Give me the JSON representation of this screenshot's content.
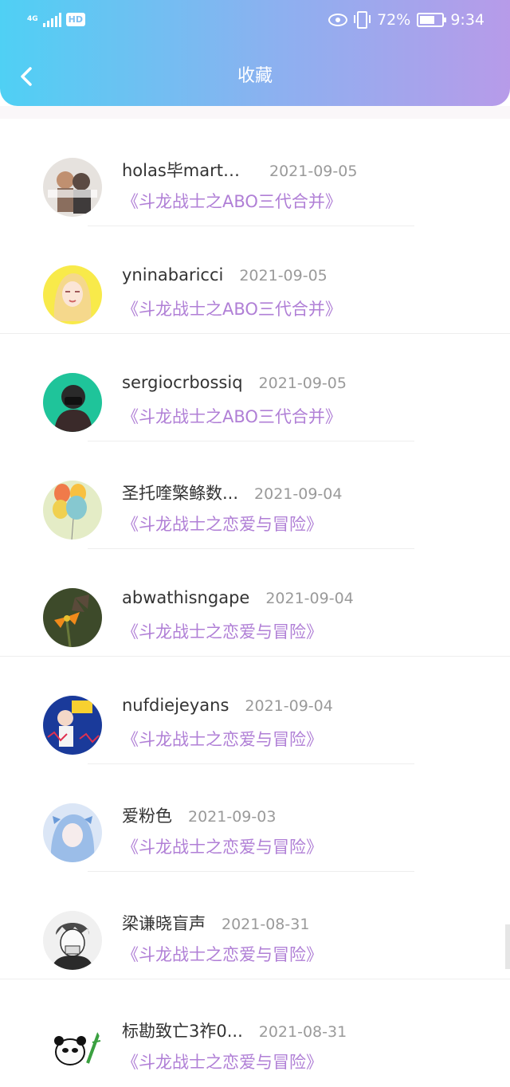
{
  "status_bar": {
    "network": "4G",
    "hd": "HD",
    "battery": "72%",
    "time": "9:34"
  },
  "header": {
    "title": "收藏"
  },
  "favorites": [
    {
      "name": "holas毕mart槎...",
      "date": "2021-09-05",
      "book": "《斗龙战士之ABO三代合并》",
      "avatar": "avatar-couple-photo"
    },
    {
      "name": "yninabaricci",
      "date": "2021-09-05",
      "book": "《斗龙战士之ABO三代合并》",
      "avatar": "avatar-blonde-anime-girl"
    },
    {
      "name": "sergiocrbossiq",
      "date": "2021-09-05",
      "book": "《斗龙战士之ABO三代合并》",
      "avatar": "avatar-masked-boy"
    },
    {
      "name": "圣托喹檠鲦数...",
      "date": "2021-09-04",
      "book": "《斗龙战士之恋爱与冒险》",
      "avatar": "avatar-balloons"
    },
    {
      "name": "abwathisngape",
      "date": "2021-09-04",
      "book": "《斗龙战士之恋爱与冒险》",
      "avatar": "avatar-butterfly-flower"
    },
    {
      "name": "nufdiejeyans",
      "date": "2021-09-04",
      "book": "《斗龙战士之恋爱与冒险》",
      "avatar": "avatar-cartoon-monday"
    },
    {
      "name": "爱粉色",
      "date": "2021-09-03",
      "book": "《斗龙战士之恋爱与冒险》",
      "avatar": "avatar-blue-hair-girl"
    },
    {
      "name": "梁谦晓盲声",
      "date": "2021-08-31",
      "book": "《斗龙战士之恋爱与冒险》",
      "avatar": "avatar-sketch-boy"
    },
    {
      "name": "标勘致亡3祚0...",
      "date": "2021-08-31",
      "book": "《斗龙战士之恋爱与冒险》",
      "avatar": "avatar-panda"
    }
  ],
  "colors": {
    "header_start": "#4fd0f4",
    "header_end": "#b79be9",
    "book_title": "#b07fd6"
  }
}
